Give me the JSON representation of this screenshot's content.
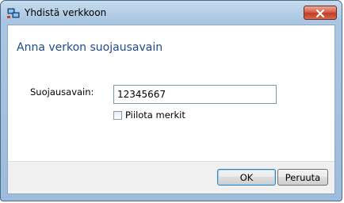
{
  "window": {
    "title": "Yhdistä verkkoon",
    "title_icon": "network-icon",
    "close_icon": "close-icon"
  },
  "main": {
    "heading": "Anna verkon suojausavain",
    "security_key_label": "Suojausavain:",
    "security_key_value": "12345667",
    "hide_characters_label": "Piilota merkit",
    "hide_characters_checked": false
  },
  "buttons": {
    "ok_label": "OK",
    "cancel_label": "Peruuta"
  }
}
